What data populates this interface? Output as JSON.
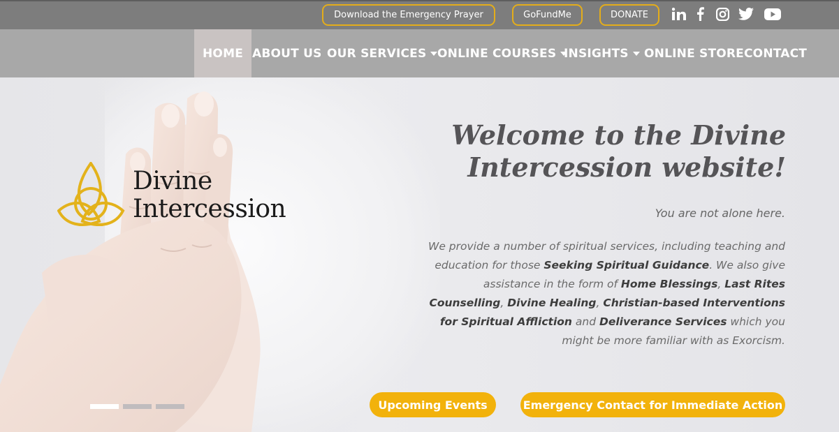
{
  "topbar": {
    "buttons": {
      "prayer": "Download the Emergency Prayer",
      "gofundme": "GoFundMe",
      "donate": "DONATE"
    },
    "social": [
      "linkedin-icon",
      "facebook-icon",
      "instagram-icon",
      "twitter-icon",
      "youtube-icon"
    ]
  },
  "nav": {
    "items": [
      {
        "label": "HOME",
        "active": true
      },
      {
        "label": "ABOUT US"
      },
      {
        "label": "OUR SERVICES",
        "dropdown": true
      },
      {
        "label": "ONLINE COURSES",
        "dropdown": true
      },
      {
        "label": "INSIGHTS",
        "dropdown": true
      },
      {
        "label": "ONLINE STORE"
      },
      {
        "label": "CONTACT"
      }
    ]
  },
  "hero": {
    "logo": {
      "line1": "Divine",
      "line2": "Intercession"
    },
    "headline": "Welcome to the Divine Intercession website!",
    "subline": "You are not alone here.",
    "paragraph": {
      "t1": "We provide a number of spiritual services, including teaching and education for those ",
      "b1": "Seeking Spiritual Guidance",
      "t2": ". We also give assistance in the form of ",
      "b2": "Home Blessings",
      "t3": ", ",
      "b3": "Last Rites Counselling",
      "t4": ", ",
      "b4": "Divine Healing",
      "t5": ", ",
      "b5": "Christian-based Interventions for Spiritual Affliction",
      "t6": " and ",
      "b6": "Deliverance Services",
      "t7": " which you might be more familiar with as Exorcism."
    },
    "buttons": {
      "events": "Upcoming Events",
      "emergency": "Emergency Contact for Immediate Action"
    },
    "slider": {
      "slides": 3,
      "active": 1
    }
  },
  "colors": {
    "accent": "#f2b20c",
    "topbar": "#7d7d7d",
    "navbar": "#a8a8a8",
    "headline": "#555457"
  }
}
